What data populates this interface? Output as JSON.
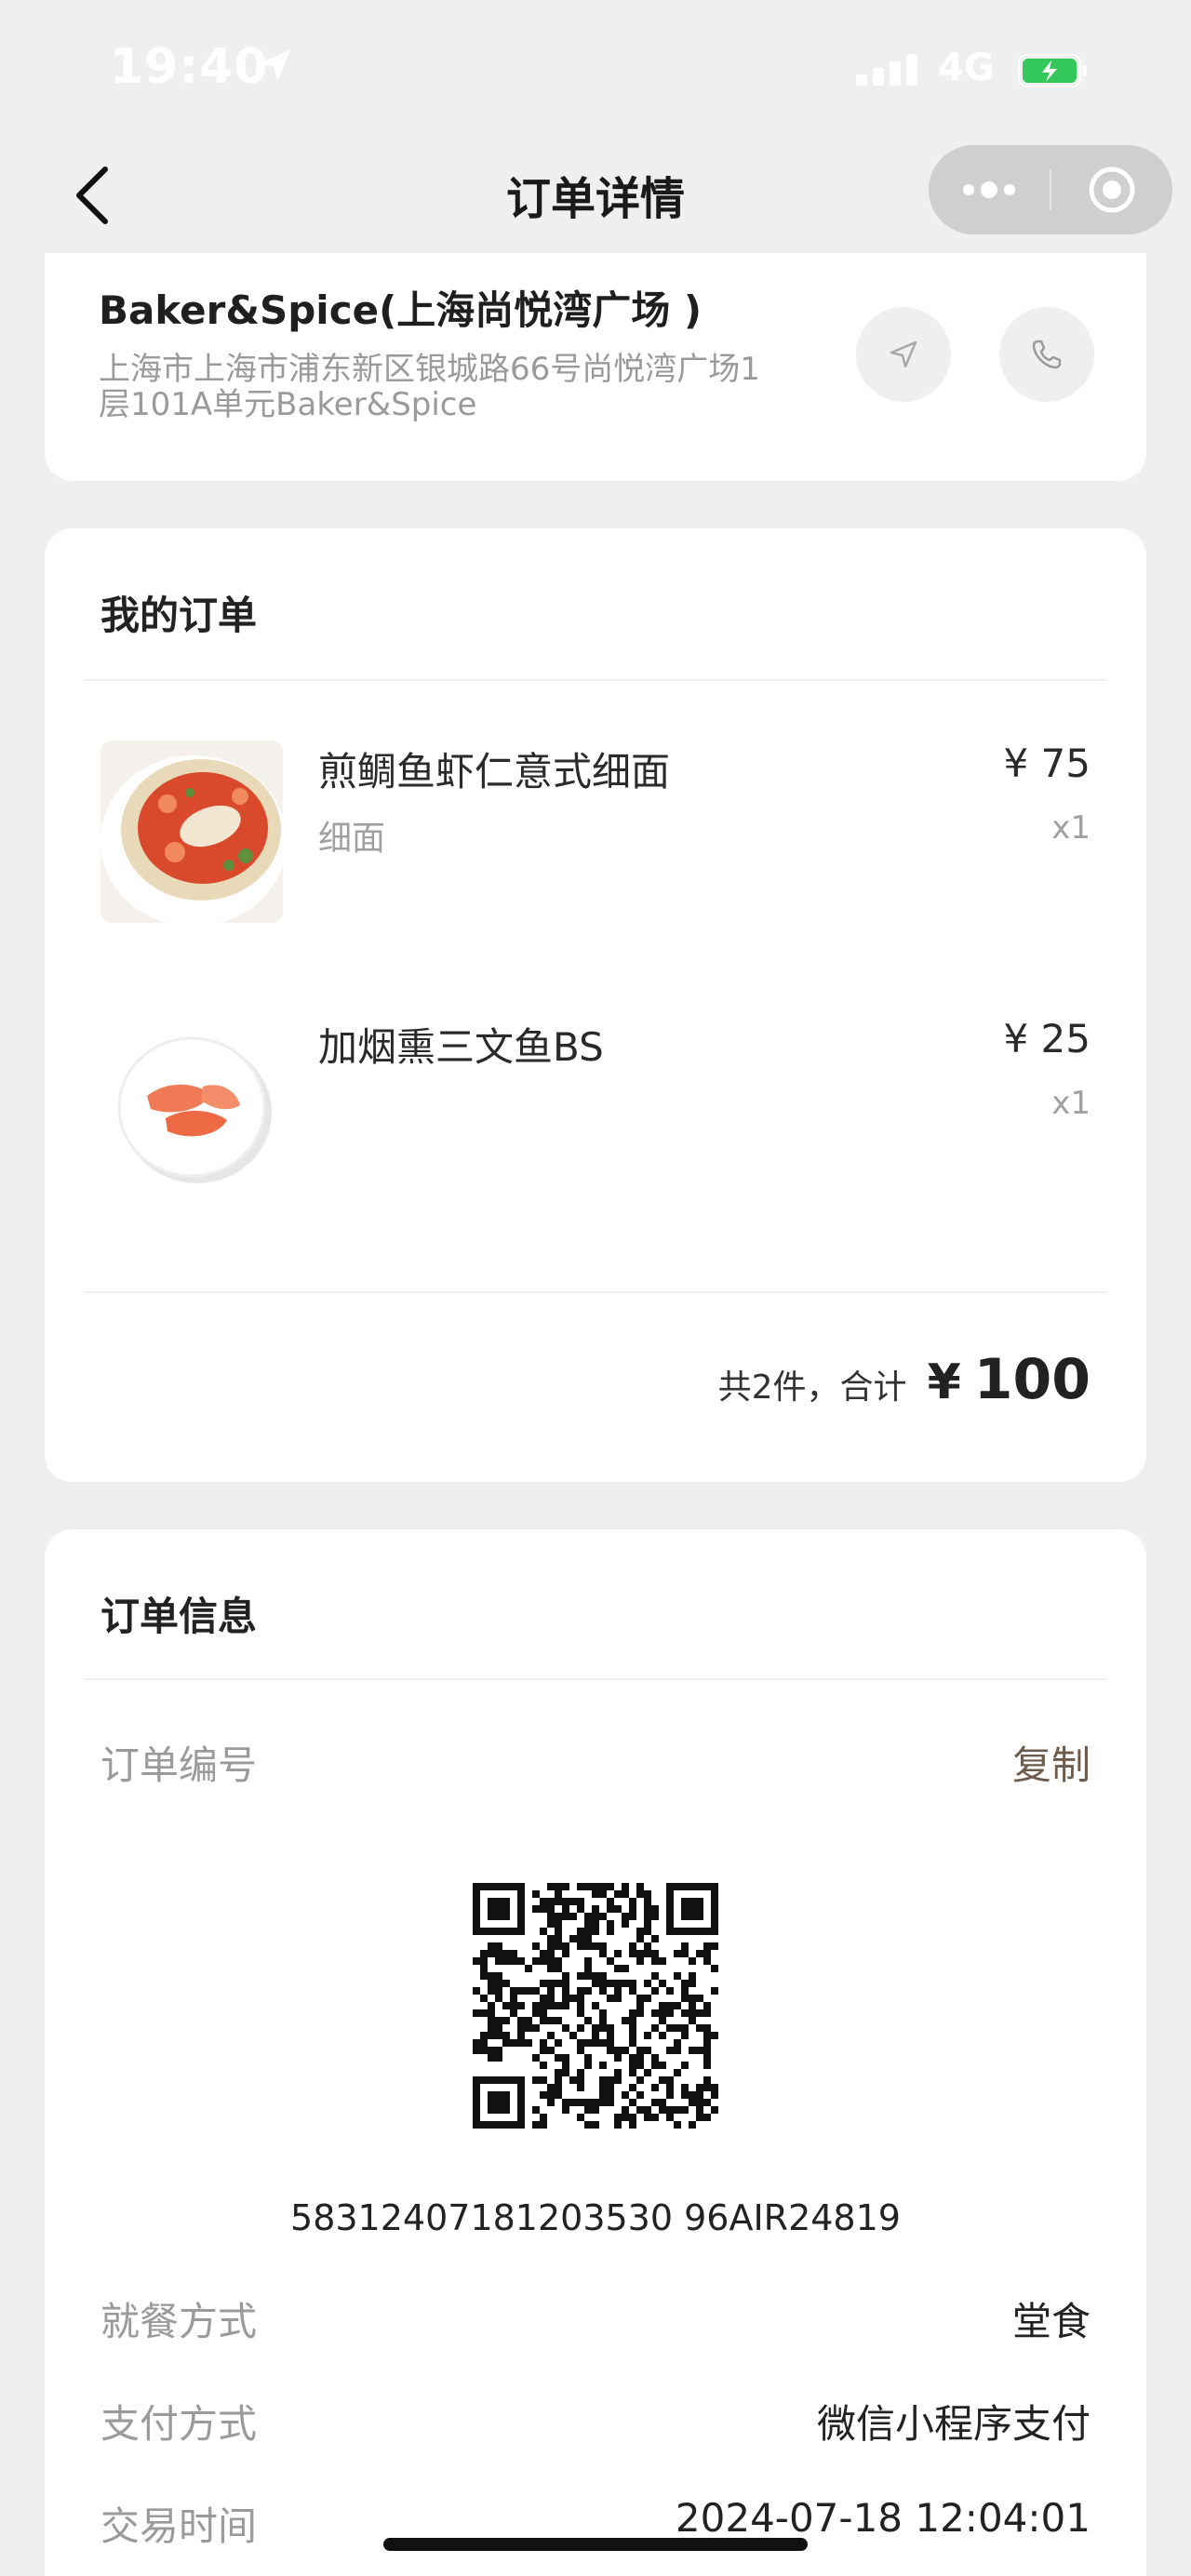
{
  "status_bar": {
    "time": "19:40",
    "network": "4G"
  },
  "nav": {
    "title": "订单详情"
  },
  "store": {
    "name": "Baker&Spice(上海尚悦湾广场 )",
    "address_line1": "上海市上海市浦东新区银城路66号尚悦湾广场1",
    "address_line2": "层101A单元Baker&Spice"
  },
  "order": {
    "title": "我的订单",
    "items": [
      {
        "name": "煎鲷鱼虾仁意式细面",
        "spec": "细面",
        "price": "¥ 75",
        "qty": "x1"
      },
      {
        "name": "加烟熏三文鱼BS",
        "spec": "",
        "price": "¥ 25",
        "qty": "x1"
      }
    ],
    "total_label": "共2件，合计",
    "total_currency": "¥",
    "total_amount": "100"
  },
  "info": {
    "title": "订单信息",
    "order_no_label": "订单编号",
    "copy_label": "复制",
    "order_no": "58312407181203530 96AIR24819",
    "dining_label": "就餐方式",
    "dining_value": "堂食",
    "payment_label": "支付方式",
    "payment_value": "微信小程序支付",
    "time_label": "交易时间",
    "time_value": "2024-07-18 12:04:01"
  },
  "colors": {
    "background": "#efeff0",
    "card": "#ffffff",
    "copy_link": "#6d5c4c",
    "battery": "#34c759"
  }
}
